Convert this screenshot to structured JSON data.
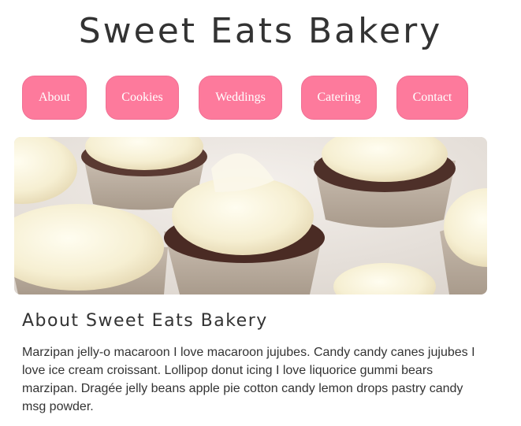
{
  "header": {
    "site_title": "Sweet Eats Bakery"
  },
  "nav": {
    "items": [
      {
        "label": "About"
      },
      {
        "label": "Cookies"
      },
      {
        "label": "Weddings"
      },
      {
        "label": "Catering"
      },
      {
        "label": "Contact"
      }
    ]
  },
  "hero": {
    "image_name": "cupcakes-photo"
  },
  "about": {
    "heading": "About Sweet Eats Bakery",
    "body": "Marzipan jelly-o macaroon I love macaroon jujubes. Candy candy canes jujubes I love ice cream croissant. Lollipop donut icing I love liquorice gummi bears marzipan. Dragée jelly beans apple pie cotton candy lemon drops pastry candy msg powder."
  },
  "colors": {
    "nav_button": "#fd7a9c",
    "text": "#333333"
  }
}
